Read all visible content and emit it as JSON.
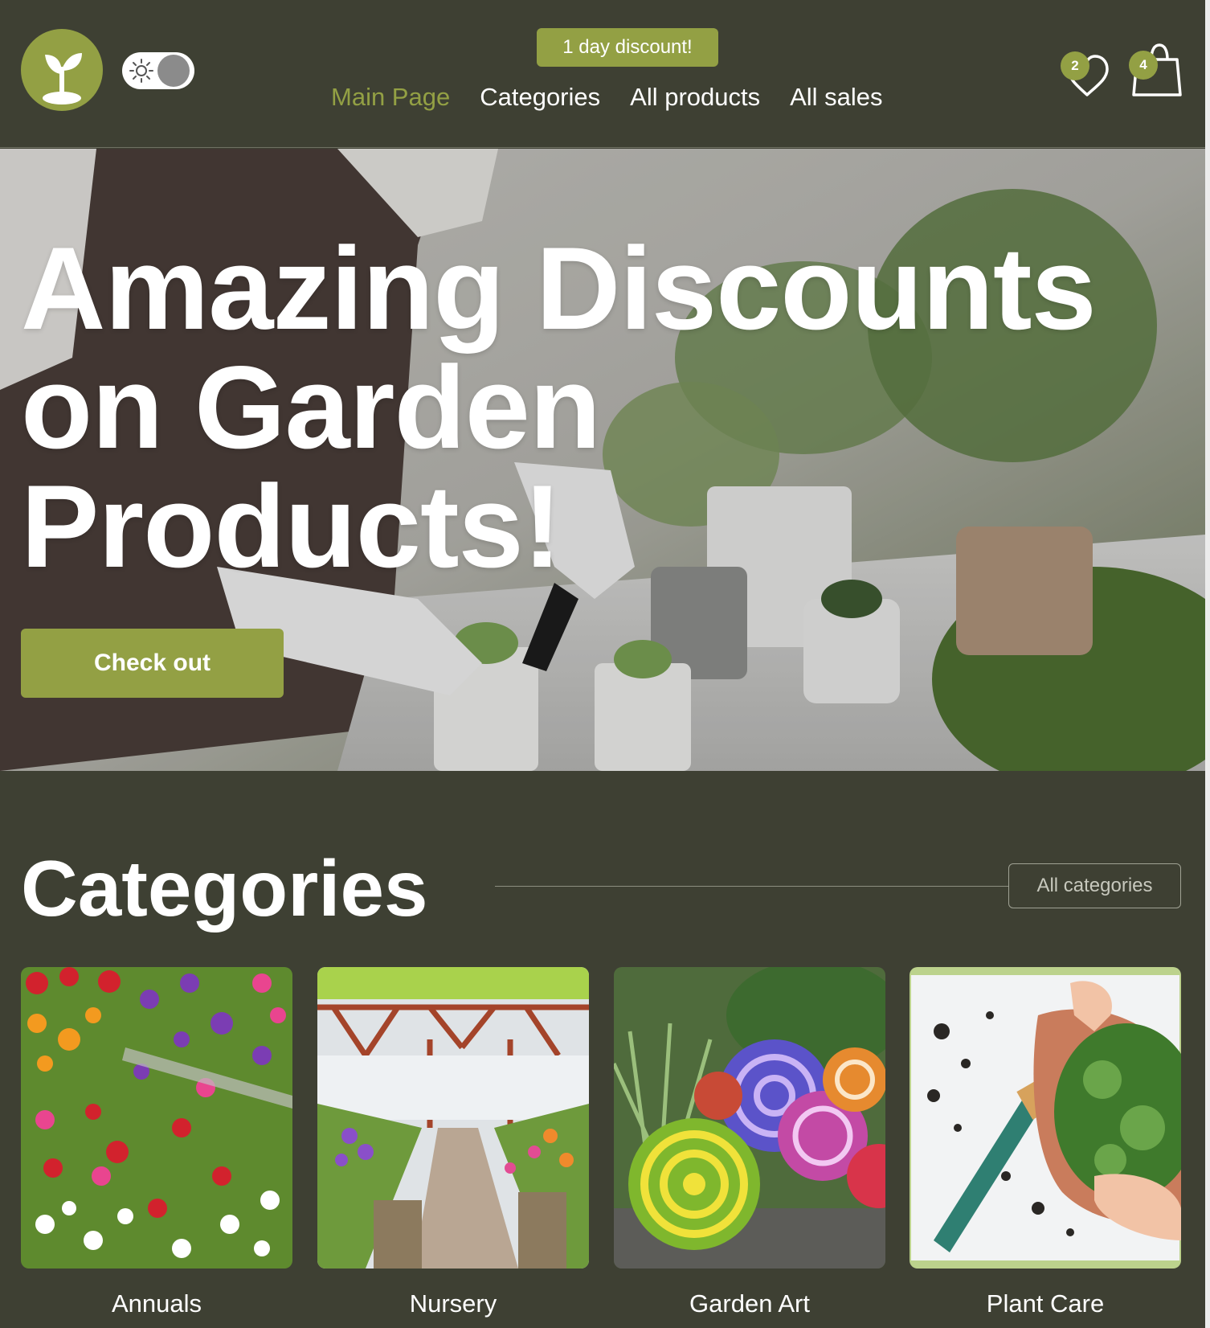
{
  "header": {
    "logo_icon": "seedling-icon",
    "theme_toggle_icon": "sun-icon",
    "promo_badge": "1 day discount!",
    "nav": [
      {
        "label": "Main Page",
        "active": true
      },
      {
        "label": "Categories",
        "active": false
      },
      {
        "label": "All products",
        "active": false
      },
      {
        "label": "All sales",
        "active": false
      }
    ],
    "wishlist": {
      "icon": "heart-icon",
      "count": "2"
    },
    "cart": {
      "icon": "shopping-bag-icon",
      "count": "4"
    }
  },
  "hero": {
    "title_lines": [
      "Amazing Discounts",
      "on Garden",
      "Products!"
    ],
    "cta_label": "Check out"
  },
  "categories": {
    "title": "Categories",
    "all_button": "All categories",
    "items": [
      {
        "label": "Annuals"
      },
      {
        "label": "Nursery"
      },
      {
        "label": "Garden Art"
      },
      {
        "label": "Plant Care"
      }
    ]
  },
  "colors": {
    "background": "#3e4033",
    "accent": "#93a044",
    "text": "#ffffff"
  }
}
